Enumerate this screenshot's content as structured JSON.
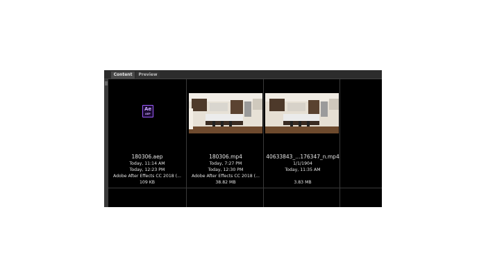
{
  "tabs": {
    "content": "Content",
    "preview": "Preview"
  },
  "files": [
    {
      "name": "180306.aep",
      "line1": "Today, 11:14 AM",
      "line2": "Today, 12:23 PM",
      "line3": "Adobe After Effects CC 2018 (...",
      "line4": "109 KB",
      "icon": "after-effects-project-icon",
      "icon_text": "Ae",
      "icon_subtext": "AEP"
    },
    {
      "name": "180306.mp4",
      "line1": "Today, 7:27 PM",
      "line2": "Today, 12:30 PM",
      "line3": "Adobe After Effects CC 2018 (...",
      "line4": "38.82 MB",
      "icon": "kitchen-video-thumbnail"
    },
    {
      "name": "40633843_...176347_n.mp4",
      "line1": "1/1/1904",
      "line2": "Today, 11:35 AM",
      "line3": "",
      "line4": "3.83 MB",
      "icon": "kitchen-video-thumbnail"
    }
  ]
}
